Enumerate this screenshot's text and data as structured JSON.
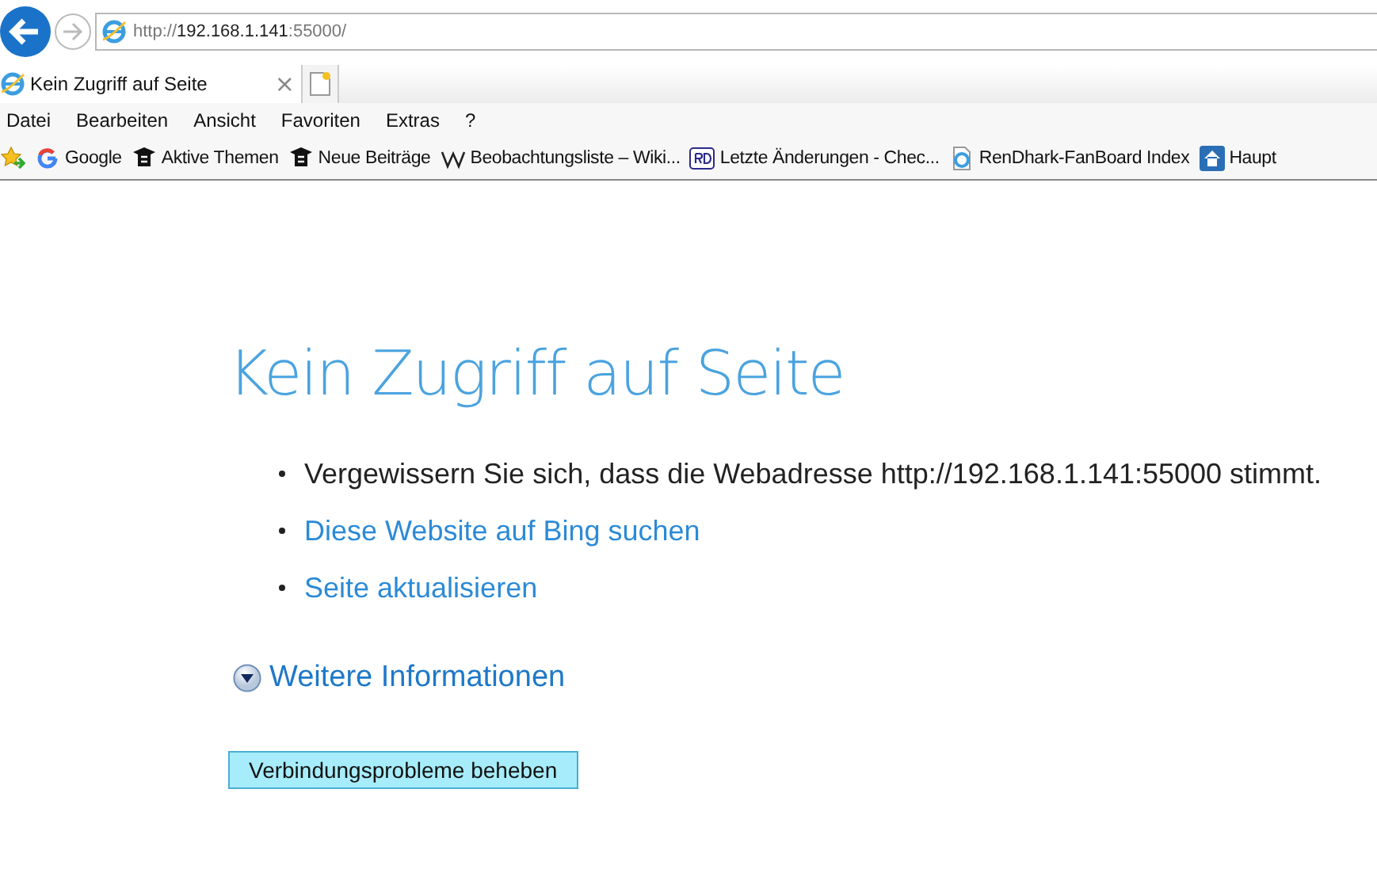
{
  "address": {
    "scheme": "http://",
    "host": "192.168.1.141",
    "rest": ":55000/"
  },
  "tabs": [
    {
      "label": "Kein Zugriff auf Seite",
      "selected": true,
      "close": "×"
    }
  ],
  "menu": [
    "Datei",
    "Bearbeiten",
    "Ansicht",
    "Favoriten",
    "Extras",
    "?"
  ],
  "favorites": [
    {
      "kind": "google",
      "label": "Google"
    },
    {
      "kind": "forum",
      "label": "Aktive Themen"
    },
    {
      "kind": "forum",
      "label": "Neue Beiträge"
    },
    {
      "kind": "wiki",
      "label": "Beobachtungsliste – Wiki..."
    },
    {
      "kind": "rd",
      "label": "Letzte Änderungen - Chec..."
    },
    {
      "kind": "page",
      "label": "RenDhark-FanBoard  Index"
    },
    {
      "kind": "home",
      "label": "Haupt"
    }
  ],
  "error": {
    "title": "Kein Zugriff auf Seite",
    "items": [
      {
        "kind": "text",
        "text": "Vergewissern Sie sich, dass die Webadresse http://192.168.1.141:55000 stimmt."
      },
      {
        "kind": "link",
        "text": "Diese Website auf Bing suchen"
      },
      {
        "kind": "link",
        "text": "Seite aktualisieren"
      }
    ],
    "more": {
      "label": "Weitere Informationen",
      "expanded": false
    },
    "button": "Verbindungsprobleme beheben"
  }
}
